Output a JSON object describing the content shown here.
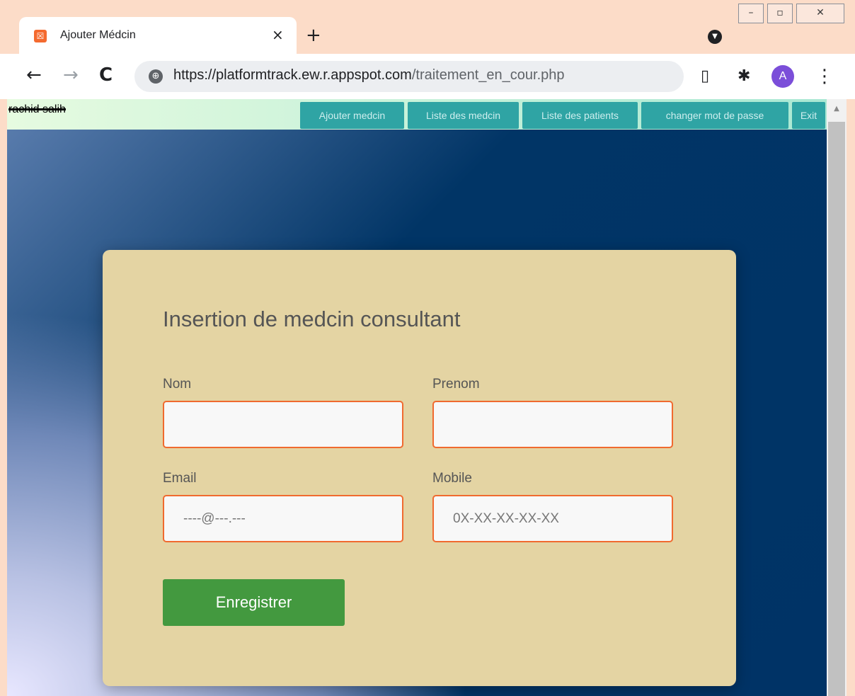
{
  "browser": {
    "tab_title": "Ajouter Médcin",
    "tab_close": "×",
    "new_tab": "+",
    "url_host": "https://platformtrack.ew.r.appspot.com",
    "url_path": "/traitement_en_cour.php",
    "profile_initial": "A",
    "window_controls": [
      "–",
      "▫",
      "✕"
    ]
  },
  "header": {
    "user_name": "rachid salih",
    "nav": [
      {
        "label": "Ajouter medcin"
      },
      {
        "label": "Liste des medcin"
      },
      {
        "label": "Liste des patients"
      },
      {
        "label": "changer mot de passe"
      },
      {
        "label": "Exit"
      }
    ]
  },
  "form": {
    "title": "Insertion de medcin consultant",
    "nom_label": "Nom",
    "prenom_label": "Prenom",
    "email_label": "Email",
    "email_placeholder": "----@---.---",
    "mobile_label": "Mobile",
    "mobile_placeholder": "0X-XX-XX-XX-XX",
    "submit_label": "Enregistrer"
  },
  "colors": {
    "card": "#e4d4a3",
    "input_border": "#f06a2f",
    "submit": "#43993f",
    "nav_button": "#2fa4a4",
    "page_bg": "#003366"
  }
}
